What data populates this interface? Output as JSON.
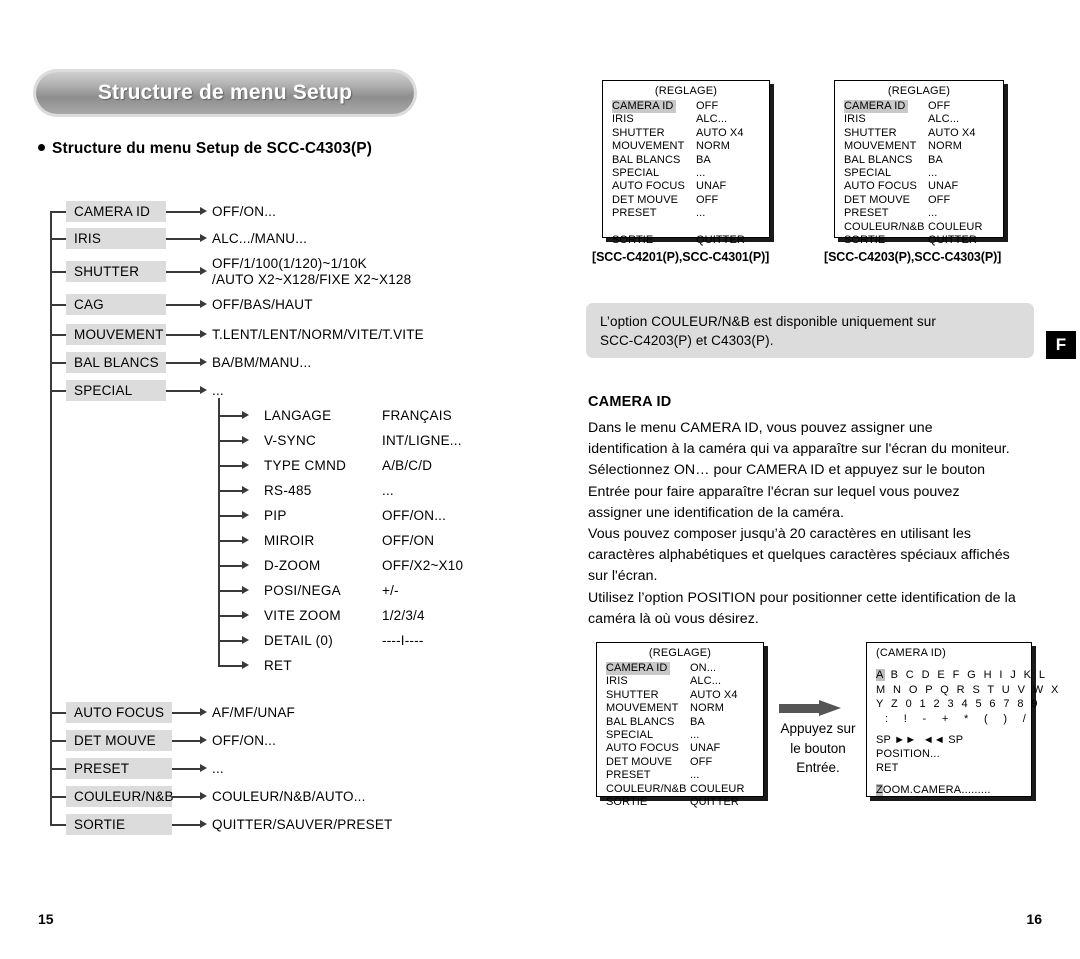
{
  "header": {
    "title": "Structure de menu Setup",
    "section_heading": "Structure du menu Setup de SCC-C4303(P)"
  },
  "lang_badge": "F",
  "page_numbers": {
    "left": "15",
    "right": "16"
  },
  "tree": {
    "items": [
      {
        "label": "CAMERA ID",
        "value": "OFF/ON..."
      },
      {
        "label": "IRIS",
        "value": "ALC.../MANU..."
      },
      {
        "label": "SHUTTER",
        "value": "OFF/1/100(1/120)~1/10K\n/AUTO X2~X128/FIXE X2~X128"
      },
      {
        "label": "CAG",
        "value": "OFF/BAS/HAUT"
      },
      {
        "label": "MOUVEMENT",
        "value": "T.LENT/LENT/NORM/VITE/T.VITE"
      },
      {
        "label": "BAL BLANCS",
        "value": "BA/BM/MANU..."
      },
      {
        "label": "SPECIAL",
        "value": "..."
      },
      {
        "label": "AUTO FOCUS",
        "value": "AF/MF/UNAF"
      },
      {
        "label": "DET MOUVE",
        "value": "OFF/ON..."
      },
      {
        "label": "PRESET",
        "value": "..."
      },
      {
        "label": "COULEUR/N&B",
        "value": "COULEUR/N&B/AUTO..."
      },
      {
        "label": "SORTIE",
        "value": "QUITTER/SAUVER/PRESET"
      }
    ],
    "special_children": [
      {
        "label": "LANGAGE",
        "value": "FRANÇAIS"
      },
      {
        "label": "V-SYNC",
        "value": "INT/LIGNE..."
      },
      {
        "label": "TYPE CMND",
        "value": "A/B/C/D"
      },
      {
        "label": "RS-485",
        "value": "..."
      },
      {
        "label": "PIP",
        "value": "OFF/ON..."
      },
      {
        "label": "MIROIR",
        "value": "OFF/ON"
      },
      {
        "label": "D-ZOOM",
        "value": "OFF/X2~X10"
      },
      {
        "label": "POSI/NEGA",
        "value": "+/-"
      },
      {
        "label": "VITE ZOOM",
        "value": "1/2/3/4"
      },
      {
        "label": "DETAIL (0)",
        "value": "----I----"
      },
      {
        "label": "RET",
        "value": ""
      }
    ]
  },
  "osd_top_left": {
    "title": "(REGLAGE)",
    "rows": [
      {
        "key": "CAMERA ID",
        "value": "OFF",
        "highlight": true
      },
      {
        "key": "IRIS",
        "value": "ALC..."
      },
      {
        "key": "SHUTTER",
        "value": "AUTO X4"
      },
      {
        "key": "MOUVEMENT",
        "value": "NORM"
      },
      {
        "key": "BAL BLANCS",
        "value": "BA"
      },
      {
        "key": "SPECIAL",
        "value": "..."
      },
      {
        "key": "AUTO FOCUS",
        "value": "UNAF"
      },
      {
        "key": "DET MOUVE",
        "value": "OFF"
      },
      {
        "key": "PRESET",
        "value": "..."
      },
      {
        "key": "",
        "value": ""
      },
      {
        "key": "SORTIE",
        "value": "QUITTER"
      }
    ],
    "caption": "[SCC-C4201(P),SCC-C4301(P)]"
  },
  "osd_top_right": {
    "title": "(REGLAGE)",
    "rows": [
      {
        "key": "CAMERA ID",
        "value": "OFF",
        "highlight": true
      },
      {
        "key": "IRIS",
        "value": "ALC..."
      },
      {
        "key": "SHUTTER",
        "value": "AUTO X4"
      },
      {
        "key": "MOUVEMENT",
        "value": "NORM"
      },
      {
        "key": "BAL BLANCS",
        "value": "BA"
      },
      {
        "key": "SPECIAL",
        "value": "..."
      },
      {
        "key": "AUTO FOCUS",
        "value": "UNAF"
      },
      {
        "key": "DET MOUVE",
        "value": "OFF"
      },
      {
        "key": "PRESET",
        "value": "..."
      },
      {
        "key": "COULEUR/N&B",
        "value": "COULEUR"
      },
      {
        "key": "SORTIE",
        "value": "QUITTER"
      }
    ],
    "caption": "[SCC-C4203(P),SCC-C4303(P)]"
  },
  "note": {
    "text": "L’option COULEUR/N&B est disponible uniquement sur\nSCC-C4203(P) et C4303(P)."
  },
  "body": {
    "heading": "CAMERA ID",
    "paragraphs": "Dans le menu CAMERA ID, vous pouvez assigner une\nidentification à la caméra qui va apparaître sur l'écran du moniteur.\nSélectionnez ON… pour CAMERA ID et appuyez sur le bouton\nEntrée pour faire apparaître l'écran sur lequel vous pouvez\nassigner une identification de la caméra.\nVous pouvez composer jusqu’à 20 caractères en utilisant les\ncaractères alphabétiques et quelques caractères spéciaux affichés\nsur l'écran.\nUtilisez l’option POSITION pour positionner cette identification de la\ncaméra là où vous désirez."
  },
  "osd_bottom_left": {
    "title": "(REGLAGE)",
    "rows": [
      {
        "key": "CAMERA ID",
        "value": "ON...",
        "highlight": true
      },
      {
        "key": "IRIS",
        "value": "ALC..."
      },
      {
        "key": "SHUTTER",
        "value": "AUTO X4"
      },
      {
        "key": "MOUVEMENT",
        "value": "NORM"
      },
      {
        "key": "BAL BLANCS",
        "value": "BA"
      },
      {
        "key": "SPECIAL",
        "value": "..."
      },
      {
        "key": "AUTO FOCUS",
        "value": "UNAF"
      },
      {
        "key": "DET MOUVE",
        "value": "OFF"
      },
      {
        "key": "PRESET",
        "value": "..."
      },
      {
        "key": "COULEUR/N&B",
        "value": "COULEUR"
      },
      {
        "key": "SORTIE",
        "value": "QUITTER"
      }
    ]
  },
  "press_note": "Appuyez sur\nle bouton\nEntrée.",
  "osd_camera_id": {
    "title": "(CAMERA ID)",
    "char_rows": [
      "A B C D E F G H I J K L",
      "M N O P Q R S T U V W X",
      "Y Z 0 1 2 3 4 5 6 7 8 9"
    ],
    "symbol_row": ":  !  -  +  *  (  )  /",
    "commands": [
      "SP ►►  ◄◄ SP",
      "POSITION...",
      "RET"
    ],
    "id_value": "ZOOM.CAMERA........."
  },
  "colors": {
    "label_bg": "#dcdcdc",
    "highlight": "#c8c8c8",
    "line": "#3a3a3a",
    "badge_bg": "#000000"
  }
}
